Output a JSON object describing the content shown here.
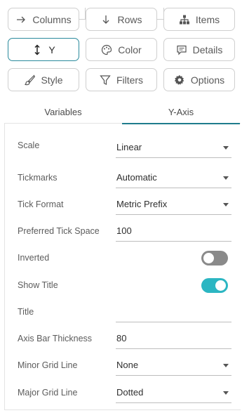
{
  "buttons": {
    "columns": {
      "label": "Columns",
      "icon": "arrow-right-icon"
    },
    "rows": {
      "label": "Rows",
      "icon": "arrow-down-icon"
    },
    "items": {
      "label": "Items",
      "icon": "hierarchy-icon"
    },
    "y": {
      "label": "Y",
      "icon": "vertical-arrows-icon",
      "active": true
    },
    "color": {
      "label": "Color",
      "icon": "palette-icon"
    },
    "details": {
      "label": "Details",
      "icon": "chat-icon"
    },
    "style": {
      "label": "Style",
      "icon": "brush-icon"
    },
    "filters": {
      "label": "Filters",
      "icon": "funnel-icon"
    },
    "options": {
      "label": "Options",
      "icon": "gear-icon"
    }
  },
  "tabs": {
    "variables": "Variables",
    "yaxis": "Y-Axis",
    "active": "Y-Axis"
  },
  "colors": {
    "accent": "#1f7c8c",
    "toggle_on": "#2cb6c2",
    "toggle_off": "#8a8a8a"
  },
  "settings": {
    "scale": {
      "label": "Scale",
      "value": "Linear"
    },
    "tickmarks": {
      "label": "Tickmarks",
      "value": "Automatic"
    },
    "tick_format": {
      "label": "Tick Format",
      "value": "Metric Prefix"
    },
    "preferred_tick_space": {
      "label": "Preferred Tick Space",
      "value": "100"
    },
    "inverted": {
      "label": "Inverted",
      "on": false
    },
    "show_title": {
      "label": "Show Title",
      "on": true
    },
    "title": {
      "label": "Title",
      "value": ""
    },
    "axis_bar_thickness": {
      "label": "Axis Bar Thickness",
      "value": "80"
    },
    "minor_grid_line": {
      "label": "Minor Grid Line",
      "value": "None"
    },
    "major_grid_line": {
      "label": "Major Grid Line",
      "value": "Dotted"
    }
  }
}
